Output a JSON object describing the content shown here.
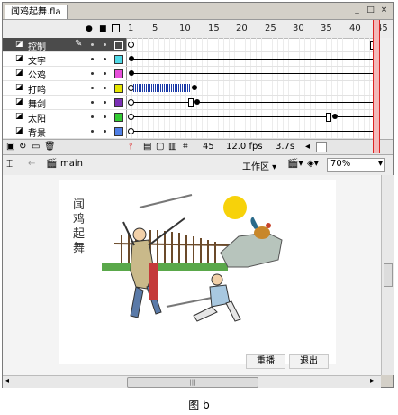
{
  "window": {
    "doc_tab": "闻鸡起舞.fla",
    "controls": [
      "_",
      "□",
      "×"
    ]
  },
  "timeline": {
    "header_icons": [
      "eye-icon",
      "lock-icon",
      "outline-icon"
    ],
    "frame_numbers": [
      "1",
      "5",
      "10",
      "15",
      "20",
      "25",
      "30",
      "35",
      "40",
      "45"
    ],
    "layers": [
      {
        "name": "控制",
        "color": "#4b4b4b",
        "selected": true
      },
      {
        "name": "文字",
        "color": "#4fd9e6",
        "selected": false
      },
      {
        "name": "公鸡",
        "color": "#e64fd9",
        "selected": false
      },
      {
        "name": "打鸣",
        "color": "#e6e600",
        "selected": false
      },
      {
        "name": "舞剑",
        "color": "#7b2fb5",
        "selected": false
      },
      {
        "name": "太阳",
        "color": "#33cc33",
        "selected": false
      },
      {
        "name": "背景",
        "color": "#4f7fe6",
        "selected": false
      }
    ],
    "footer": {
      "current_frame": "45",
      "frame_rate": "12.0 fps",
      "elapsed": "3.7s"
    }
  },
  "editbar": {
    "scene": "main",
    "workspace": "工作区",
    "zoom": "70%"
  },
  "stage": {
    "vertical_title": "闻鸡起舞",
    "replay_button": "重播",
    "exit_button": "退出"
  },
  "caption": "图 b",
  "colors": {
    "sun": "#f7d20a",
    "playhead": "#d22222",
    "waveform": "#1a3aa8"
  }
}
